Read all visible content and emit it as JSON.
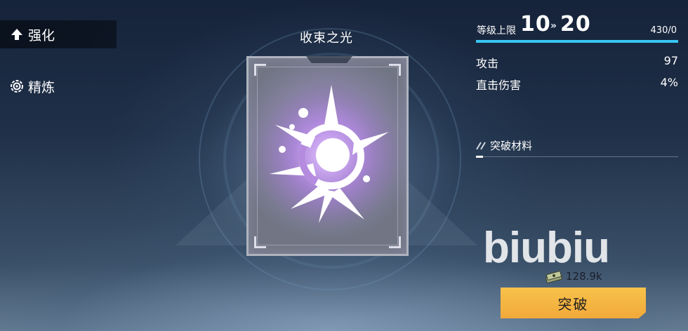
{
  "sidebar": {
    "tabs": [
      {
        "label": "强化",
        "icon": "up-arrow-icon",
        "active": true
      },
      {
        "label": "精炼",
        "icon": "gear-icon",
        "active": false
      }
    ]
  },
  "card": {
    "name": "收束之光",
    "emblem_icon": "radiant-star-emblem-icon",
    "glow_color": "#c9a3ff"
  },
  "level": {
    "label": "等级上限",
    "current": "10",
    "arrow": "»",
    "target": "20",
    "exp_text": "430/0",
    "exp_fill_fraction": 1.0,
    "bar_color": "#39c6f2"
  },
  "stats": [
    {
      "name": "攻击",
      "value": "97"
    },
    {
      "name": "直击伤害",
      "value": "4%"
    }
  ],
  "materials": {
    "title": "突破材料"
  },
  "watermark": "biubiu",
  "cost": {
    "icon": "money-stack-icon",
    "amount": "128.9k"
  },
  "break_button": {
    "label": "突破",
    "color": "#f4b443"
  }
}
